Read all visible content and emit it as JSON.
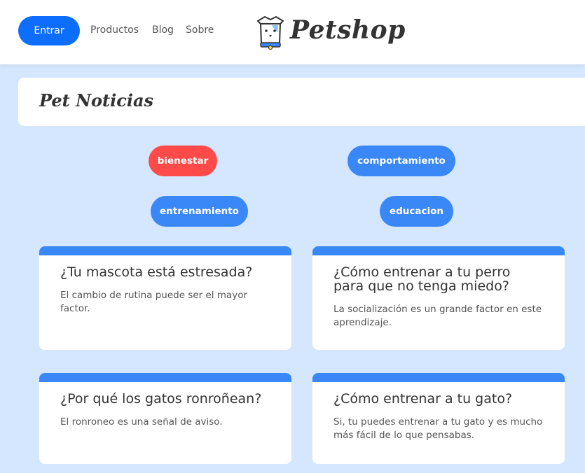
{
  "header": {
    "login_label": "Entrar",
    "nav": [
      "Productos",
      "Blog",
      "Sobre"
    ],
    "logo_text": "Petshop"
  },
  "page": {
    "title": "Pet Noticias"
  },
  "categories": [
    {
      "label": "bienestar",
      "color": "#ff4a4a"
    },
    {
      "label": "comportamiento",
      "color": "#3a87f7"
    },
    {
      "label": "entrenamiento",
      "color": "#3a87f7"
    },
    {
      "label": "educacion",
      "color": "#3a87f7"
    }
  ],
  "articles": [
    {
      "title": "¿Tu mascota está estresada?",
      "summary": "El cambio de rutina puede ser el mayor factor."
    },
    {
      "title": "¿Cómo entrenar a tu perro para que no tenga miedo?",
      "summary": "La socialización es un grande factor en este aprendizaje."
    },
    {
      "title": "¿Por qué los gatos ronroñean?",
      "summary": "El ronroneo es una señal de aviso."
    },
    {
      "title": "¿Cómo entrenar a tu gato?",
      "summary": "Si, tu puedes entrenar a tu gato y es mucho más fácil de lo que pensabas."
    }
  ],
  "colors": {
    "primary": "#0d6efd",
    "accent": "#3a87f7",
    "active_category": "#ff4a4a",
    "background": "#d4e7ff"
  }
}
